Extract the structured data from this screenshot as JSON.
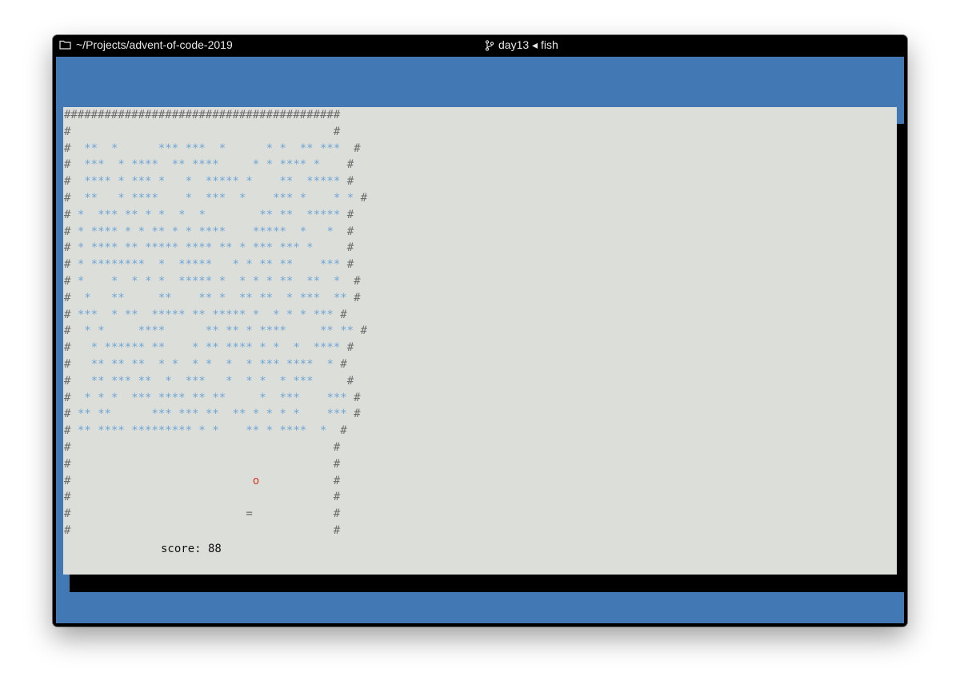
{
  "window": {
    "path": "~/Projects/advent-of-code-2019",
    "title": "day13 ◂ fish",
    "folder_icon": "folder-icon",
    "branch_icon": "git-branch-icon"
  },
  "colors": {
    "background": "#4279b4",
    "panel": "#dcdfd9",
    "wall": "#6e6e6e",
    "block": "#6fa4d6",
    "ball": "#d23a2a"
  },
  "game": {
    "rows": [
      "#########################################",
      "#                                       #",
      "#  **  *      *** ***  *      * *  ** ***  #",
      "#  ***  * ****  ** ****     * * **** *    #",
      "#  **** * *** *   *  ***** *    **  ***** #",
      "#  **   * ****    *  ***  *    *** *    * * #",
      "# *  *** ** * *  *  *        ** **  ***** #",
      "# * **** * * ** * * ****    *****  *   *  #",
      "# * **** ** ***** **** ** * *** *** *     #",
      "# * ********  *  *****   * * ** **    *** #",
      "# *    *  * * *  ***** *  * * * **  **  *  #",
      "#  *   **     **    ** *  ** **  * ***  ** #",
      "# ***  * **  ***** ** ***** *  * * * *** #",
      "#  * *     ****      ** ** * ****     ** ** #",
      "#   * ****** **    * ** **** * *  *  **** #",
      "#   ** ** **  * *  * *  *  * *** ****  * #",
      "#   ** *** **  *  ***   *  * *  * ***     #",
      "#  * * *  *** **** ** **     *  ***    *** #",
      "# ** **      *** *** **  ** * * * *    *** #",
      "# ** **** ********* * *    ** * ****  *  #",
      "#                                       #",
      "#                                       #",
      "#                           o           #",
      "#                                       #",
      "#                          =            #",
      "#                                       #"
    ],
    "score": "score: 88"
  }
}
